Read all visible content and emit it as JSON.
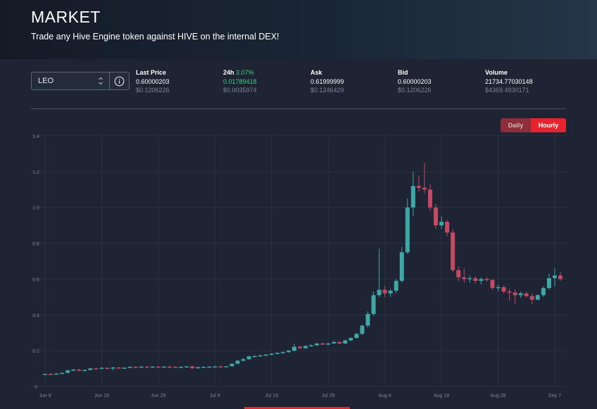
{
  "header": {
    "title": "MARKET",
    "subtitle": "Trade any Hive Engine token against HIVE on the internal DEX!"
  },
  "token_select": {
    "value": "LEO"
  },
  "stats": [
    {
      "label": "Last Price",
      "value": "0.60000203",
      "usd": "$0.1206226"
    },
    {
      "label": "24h",
      "change": "3.07%",
      "value": "0.01789418",
      "usd": "$0.0035974"
    },
    {
      "label": "Ask",
      "value": "0.61999999",
      "usd": "$0.1246429"
    },
    {
      "label": "Bid",
      "value": "0.60000203",
      "usd": "$0.1206226"
    },
    {
      "label": "Volume",
      "value": "21734.77030148",
      "usd": "$4369.4930171"
    }
  ],
  "toggle": {
    "daily": "Daily",
    "hourly": "Hourly",
    "active": "hourly"
  },
  "colors": {
    "up": "#3fa7a6",
    "down": "#c24b63",
    "accent": "#e8232d",
    "positive": "#3fd07c"
  },
  "chart_data": {
    "type": "candlestick",
    "x_ticks": [
      "Jun 9",
      "Jun 19",
      "Jun 29",
      "Jul 9",
      "Jul 19",
      "Jul 29",
      "Aug 8",
      "Aug 18",
      "Aug 28",
      "Sep 7"
    ],
    "y_ticks": [
      "0",
      "0.2",
      "0.4",
      "0.6",
      "0.8",
      "1.0",
      "1.2",
      "1.4"
    ],
    "ylim": [
      0,
      1.4
    ],
    "grid": true,
    "candles": [
      {
        "date": "2021-06-09",
        "o": 0.068,
        "h": 0.072,
        "l": 0.066,
        "c": 0.07
      },
      {
        "date": "2021-06-10",
        "o": 0.07,
        "h": 0.073,
        "l": 0.067,
        "c": 0.069
      },
      {
        "date": "2021-06-11",
        "o": 0.069,
        "h": 0.074,
        "l": 0.067,
        "c": 0.072
      },
      {
        "date": "2021-06-12",
        "o": 0.072,
        "h": 0.078,
        "l": 0.07,
        "c": 0.076
      },
      {
        "date": "2021-06-13",
        "o": 0.076,
        "h": 0.094,
        "l": 0.074,
        "c": 0.09
      },
      {
        "date": "2021-06-14",
        "o": 0.09,
        "h": 0.098,
        "l": 0.086,
        "c": 0.094
      },
      {
        "date": "2021-06-15",
        "o": 0.094,
        "h": 0.097,
        "l": 0.085,
        "c": 0.088
      },
      {
        "date": "2021-06-16",
        "o": 0.088,
        "h": 0.095,
        "l": 0.085,
        "c": 0.092
      },
      {
        "date": "2021-06-17",
        "o": 0.092,
        "h": 0.104,
        "l": 0.09,
        "c": 0.101
      },
      {
        "date": "2021-06-18",
        "o": 0.101,
        "h": 0.105,
        "l": 0.097,
        "c": 0.1
      },
      {
        "date": "2021-06-19",
        "o": 0.1,
        "h": 0.108,
        "l": 0.098,
        "c": 0.104
      },
      {
        "date": "2021-06-20",
        "o": 0.104,
        "h": 0.107,
        "l": 0.098,
        "c": 0.101
      },
      {
        "date": "2021-06-21",
        "o": 0.101,
        "h": 0.11,
        "l": 0.09,
        "c": 0.106
      },
      {
        "date": "2021-06-22",
        "o": 0.106,
        "h": 0.11,
        "l": 0.1,
        "c": 0.102
      },
      {
        "date": "2021-06-23",
        "o": 0.102,
        "h": 0.107,
        "l": 0.099,
        "c": 0.105
      },
      {
        "date": "2021-06-24",
        "o": 0.105,
        "h": 0.112,
        "l": 0.103,
        "c": 0.11
      },
      {
        "date": "2021-06-25",
        "o": 0.11,
        "h": 0.113,
        "l": 0.105,
        "c": 0.108
      },
      {
        "date": "2021-06-26",
        "o": 0.108,
        "h": 0.113,
        "l": 0.106,
        "c": 0.111
      },
      {
        "date": "2021-06-27",
        "o": 0.111,
        "h": 0.114,
        "l": 0.108,
        "c": 0.11
      },
      {
        "date": "2021-06-28",
        "o": 0.11,
        "h": 0.113,
        "l": 0.107,
        "c": 0.111
      },
      {
        "date": "2021-06-29",
        "o": 0.111,
        "h": 0.114,
        "l": 0.108,
        "c": 0.11
      },
      {
        "date": "2021-06-30",
        "o": 0.11,
        "h": 0.113,
        "l": 0.107,
        "c": 0.111
      },
      {
        "date": "2021-07-01",
        "o": 0.111,
        "h": 0.114,
        "l": 0.108,
        "c": 0.11
      },
      {
        "date": "2021-07-02",
        "o": 0.11,
        "h": 0.113,
        "l": 0.107,
        "c": 0.109
      },
      {
        "date": "2021-07-03",
        "o": 0.109,
        "h": 0.112,
        "l": 0.106,
        "c": 0.11
      },
      {
        "date": "2021-07-04",
        "o": 0.11,
        "h": 0.114,
        "l": 0.107,
        "c": 0.112
      },
      {
        "date": "2021-07-05",
        "o": 0.112,
        "h": 0.115,
        "l": 0.098,
        "c": 0.102
      },
      {
        "date": "2021-07-06",
        "o": 0.102,
        "h": 0.11,
        "l": 0.099,
        "c": 0.108
      },
      {
        "date": "2021-07-07",
        "o": 0.108,
        "h": 0.112,
        "l": 0.105,
        "c": 0.11
      },
      {
        "date": "2021-07-08",
        "o": 0.11,
        "h": 0.113,
        "l": 0.107,
        "c": 0.111
      },
      {
        "date": "2021-07-09",
        "o": 0.111,
        "h": 0.114,
        "l": 0.108,
        "c": 0.112
      },
      {
        "date": "2021-07-10",
        "o": 0.112,
        "h": 0.115,
        "l": 0.108,
        "c": 0.111
      },
      {
        "date": "2021-07-11",
        "o": 0.111,
        "h": 0.114,
        "l": 0.108,
        "c": 0.113
      },
      {
        "date": "2021-07-12",
        "o": 0.113,
        "h": 0.13,
        "l": 0.111,
        "c": 0.127
      },
      {
        "date": "2021-07-13",
        "o": 0.127,
        "h": 0.148,
        "l": 0.124,
        "c": 0.144
      },
      {
        "date": "2021-07-14",
        "o": 0.144,
        "h": 0.16,
        "l": 0.14,
        "c": 0.152
      },
      {
        "date": "2021-07-15",
        "o": 0.152,
        "h": 0.172,
        "l": 0.15,
        "c": 0.168
      },
      {
        "date": "2021-07-16",
        "o": 0.168,
        "h": 0.174,
        "l": 0.164,
        "c": 0.17
      },
      {
        "date": "2021-07-17",
        "o": 0.17,
        "h": 0.176,
        "l": 0.166,
        "c": 0.174
      },
      {
        "date": "2021-07-18",
        "o": 0.174,
        "h": 0.182,
        "l": 0.17,
        "c": 0.178
      },
      {
        "date": "2021-07-19",
        "o": 0.178,
        "h": 0.186,
        "l": 0.174,
        "c": 0.183
      },
      {
        "date": "2021-07-20",
        "o": 0.183,
        "h": 0.19,
        "l": 0.179,
        "c": 0.188
      },
      {
        "date": "2021-07-21",
        "o": 0.188,
        "h": 0.196,
        "l": 0.184,
        "c": 0.192
      },
      {
        "date": "2021-07-22",
        "o": 0.192,
        "h": 0.203,
        "l": 0.188,
        "c": 0.2
      },
      {
        "date": "2021-07-23",
        "o": 0.2,
        "h": 0.24,
        "l": 0.196,
        "c": 0.222
      },
      {
        "date": "2021-07-24",
        "o": 0.222,
        "h": 0.228,
        "l": 0.21,
        "c": 0.214
      },
      {
        "date": "2021-07-25",
        "o": 0.214,
        "h": 0.23,
        "l": 0.21,
        "c": 0.226
      },
      {
        "date": "2021-07-26",
        "o": 0.226,
        "h": 0.234,
        "l": 0.222,
        "c": 0.23
      },
      {
        "date": "2021-07-27",
        "o": 0.23,
        "h": 0.244,
        "l": 0.226,
        "c": 0.24
      },
      {
        "date": "2021-07-28",
        "o": 0.24,
        "h": 0.246,
        "l": 0.232,
        "c": 0.236
      },
      {
        "date": "2021-07-29",
        "o": 0.236,
        "h": 0.244,
        "l": 0.232,
        "c": 0.24
      },
      {
        "date": "2021-07-30",
        "o": 0.24,
        "h": 0.258,
        "l": 0.238,
        "c": 0.248
      },
      {
        "date": "2021-07-31",
        "o": 0.248,
        "h": 0.254,
        "l": 0.236,
        "c": 0.24
      },
      {
        "date": "2021-08-01",
        "o": 0.24,
        "h": 0.262,
        "l": 0.238,
        "c": 0.257
      },
      {
        "date": "2021-08-02",
        "o": 0.257,
        "h": 0.275,
        "l": 0.254,
        "c": 0.271
      },
      {
        "date": "2021-08-03",
        "o": 0.271,
        "h": 0.3,
        "l": 0.268,
        "c": 0.294
      },
      {
        "date": "2021-08-04",
        "o": 0.294,
        "h": 0.345,
        "l": 0.29,
        "c": 0.34
      },
      {
        "date": "2021-08-05",
        "o": 0.34,
        "h": 0.42,
        "l": 0.33,
        "c": 0.405
      },
      {
        "date": "2021-08-06",
        "o": 0.405,
        "h": 0.53,
        "l": 0.395,
        "c": 0.51
      },
      {
        "date": "2021-08-07",
        "o": 0.51,
        "h": 0.77,
        "l": 0.5,
        "c": 0.54
      },
      {
        "date": "2021-08-08",
        "o": 0.54,
        "h": 0.56,
        "l": 0.5,
        "c": 0.52
      },
      {
        "date": "2021-08-09",
        "o": 0.52,
        "h": 0.545,
        "l": 0.5,
        "c": 0.535
      },
      {
        "date": "2021-08-10",
        "o": 0.535,
        "h": 0.6,
        "l": 0.52,
        "c": 0.59
      },
      {
        "date": "2021-08-11",
        "o": 0.59,
        "h": 0.78,
        "l": 0.58,
        "c": 0.75
      },
      {
        "date": "2021-08-12",
        "o": 0.75,
        "h": 1.05,
        "l": 0.74,
        "c": 1.0
      },
      {
        "date": "2021-08-13",
        "o": 1.0,
        "h": 1.2,
        "l": 0.95,
        "c": 1.12
      },
      {
        "date": "2021-08-14",
        "o": 1.12,
        "h": 1.18,
        "l": 1.09,
        "c": 1.11
      },
      {
        "date": "2021-08-15",
        "o": 1.11,
        "h": 1.25,
        "l": 1.08,
        "c": 1.1
      },
      {
        "date": "2021-08-16",
        "o": 1.1,
        "h": 1.13,
        "l": 0.98,
        "c": 1.0
      },
      {
        "date": "2021-08-17",
        "o": 1.0,
        "h": 1.02,
        "l": 0.88,
        "c": 0.9
      },
      {
        "date": "2021-08-18",
        "o": 0.9,
        "h": 0.95,
        "l": 0.88,
        "c": 0.92
      },
      {
        "date": "2021-08-19",
        "o": 0.92,
        "h": 0.93,
        "l": 0.84,
        "c": 0.86
      },
      {
        "date": "2021-08-20",
        "o": 0.86,
        "h": 0.88,
        "l": 0.64,
        "c": 0.65
      },
      {
        "date": "2021-08-21",
        "o": 0.65,
        "h": 0.67,
        "l": 0.59,
        "c": 0.61
      },
      {
        "date": "2021-08-22",
        "o": 0.61,
        "h": 0.66,
        "l": 0.58,
        "c": 0.6
      },
      {
        "date": "2021-08-23",
        "o": 0.6,
        "h": 0.62,
        "l": 0.58,
        "c": 0.605
      },
      {
        "date": "2021-08-24",
        "o": 0.605,
        "h": 0.615,
        "l": 0.575,
        "c": 0.59
      },
      {
        "date": "2021-08-25",
        "o": 0.59,
        "h": 0.61,
        "l": 0.57,
        "c": 0.6
      },
      {
        "date": "2021-08-26",
        "o": 0.6,
        "h": 0.612,
        "l": 0.585,
        "c": 0.595
      },
      {
        "date": "2021-08-27",
        "o": 0.595,
        "h": 0.6,
        "l": 0.54,
        "c": 0.55
      },
      {
        "date": "2021-08-28",
        "o": 0.55,
        "h": 0.57,
        "l": 0.53,
        "c": 0.555
      },
      {
        "date": "2021-08-29",
        "o": 0.555,
        "h": 0.565,
        "l": 0.52,
        "c": 0.53
      },
      {
        "date": "2021-08-30",
        "o": 0.53,
        "h": 0.545,
        "l": 0.48,
        "c": 0.525
      },
      {
        "date": "2021-08-31",
        "o": 0.525,
        "h": 0.54,
        "l": 0.46,
        "c": 0.51
      },
      {
        "date": "2021-09-01",
        "o": 0.51,
        "h": 0.53,
        "l": 0.495,
        "c": 0.52
      },
      {
        "date": "2021-09-02",
        "o": 0.52,
        "h": 0.53,
        "l": 0.5,
        "c": 0.505
      },
      {
        "date": "2021-09-03",
        "o": 0.505,
        "h": 0.52,
        "l": 0.46,
        "c": 0.485
      },
      {
        "date": "2021-09-04",
        "o": 0.485,
        "h": 0.515,
        "l": 0.48,
        "c": 0.51
      },
      {
        "date": "2021-09-05",
        "o": 0.51,
        "h": 0.56,
        "l": 0.5,
        "c": 0.55
      },
      {
        "date": "2021-09-06",
        "o": 0.55,
        "h": 0.63,
        "l": 0.54,
        "c": 0.605
      },
      {
        "date": "2021-09-07",
        "o": 0.605,
        "h": 0.66,
        "l": 0.56,
        "c": 0.62
      },
      {
        "date": "2021-09-08",
        "o": 0.62,
        "h": 0.64,
        "l": 0.59,
        "c": 0.6
      }
    ]
  }
}
